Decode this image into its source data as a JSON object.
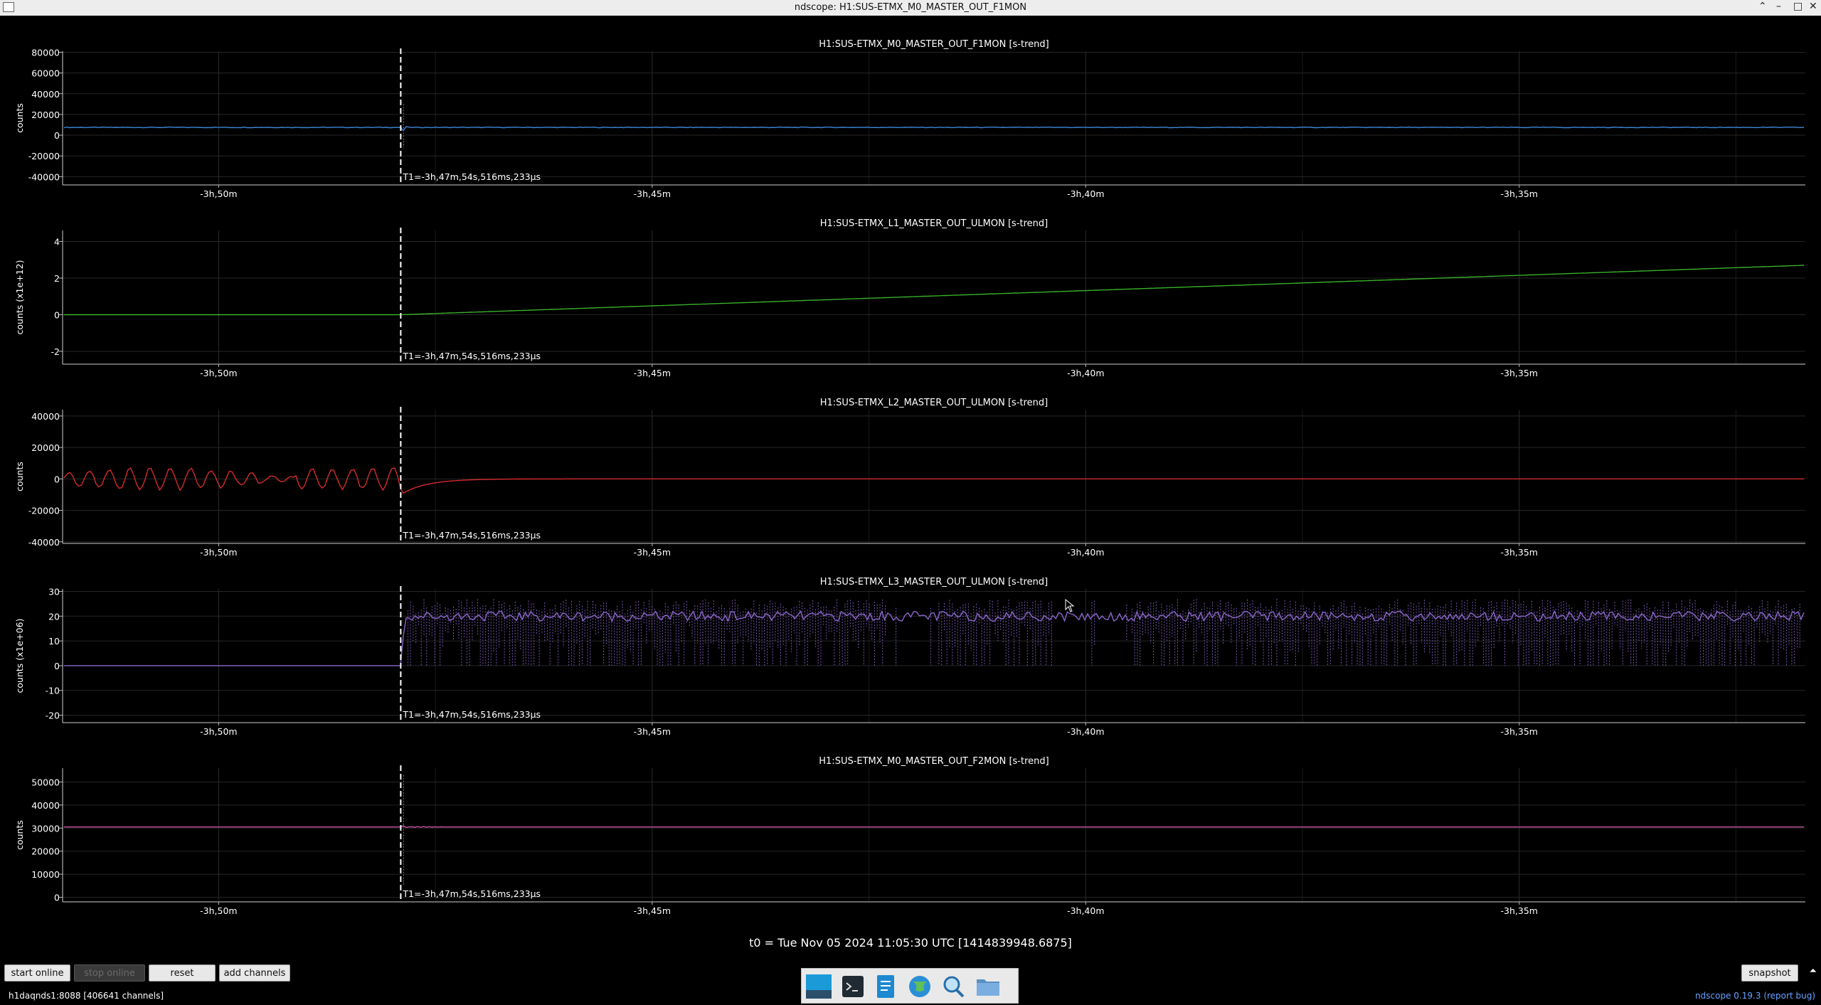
{
  "window": {
    "title": "ndscope: H1:SUS-ETMX_M0_MASTER_OUT_F1MON",
    "controls": [
      "⌃",
      "–",
      "□",
      "✕"
    ]
  },
  "cursor_label": "T1=-3h,47m,54s,516ms,233µs",
  "time_axis": {
    "ticks": [
      "-3h,50m",
      "-3h,45m",
      "-3h,40m",
      "-3h,35m"
    ],
    "tick_values_min": [
      -230,
      -225,
      -220,
      -215
    ],
    "range_min": [
      -231.8,
      -211.7
    ],
    "cursor_min": -227.9
  },
  "plots": [
    {
      "title": "H1:SUS-ETMX_M0_MASTER_OUT_F1MON [s-trend]",
      "ylabel": "counts",
      "yticks": [
        "80000",
        "60000",
        "40000",
        "20000",
        "0",
        "-20000",
        "-40000"
      ],
      "ytick_values": [
        80000,
        60000,
        40000,
        20000,
        0,
        -20000,
        -40000
      ],
      "ylim": [
        -48000,
        81000
      ],
      "color": "#3f86d6",
      "shape": "flat",
      "level": 7500
    },
    {
      "title": "H1:SUS-ETMX_L1_MASTER_OUT_ULMON [s-trend]",
      "ylabel": "counts (x1e+12)",
      "yticks": [
        "4",
        "2",
        "0",
        "-2"
      ],
      "ytick_values": [
        4,
        2,
        0,
        -2
      ],
      "ylim": [
        -2.7,
        4.6
      ],
      "color": "#39b22a",
      "shape": "ramp",
      "level": 0,
      "end_value": 2.7
    },
    {
      "title": "H1:SUS-ETMX_L2_MASTER_OUT_ULMON [s-trend]",
      "ylabel": "counts",
      "yticks": [
        "40000",
        "20000",
        "0",
        "-20000",
        "-40000"
      ],
      "ytick_values": [
        40000,
        20000,
        0,
        -20000,
        -40000
      ],
      "ylim": [
        -41000,
        44000
      ],
      "color": "#d42b2b",
      "shape": "oscillate",
      "level": 0
    },
    {
      "title": "H1:SUS-ETMX_L3_MASTER_OUT_ULMON [s-trend]",
      "ylabel": "counts (x1e+06)",
      "yticks": [
        "30",
        "20",
        "10",
        "0",
        "-10",
        "-20"
      ],
      "ytick_values": [
        30,
        20,
        10,
        0,
        -10,
        -20
      ],
      "ylim": [
        -23,
        31
      ],
      "color": "#8a66cc",
      "shape": "noisy",
      "level": 20
    },
    {
      "title": "H1:SUS-ETMX_M0_MASTER_OUT_F2MON [s-trend]",
      "ylabel": "counts",
      "yticks": [
        "50000",
        "40000",
        "30000",
        "20000",
        "10000",
        "0"
      ],
      "ytick_values": [
        50000,
        40000,
        30000,
        20000,
        10000,
        0
      ],
      "ylim": [
        -2000,
        56000
      ],
      "color": "#c24fa3",
      "shape": "flat_spike",
      "level": 30500
    }
  ],
  "t0_label": "t0 = Tue Nov 05 2024 11:05:30 UTC [1414839948.6875]",
  "buttons": {
    "start_online": "start online",
    "stop_online": "stop online",
    "reset": "reset",
    "add_channels": "add channels",
    "snapshot": "snapshot"
  },
  "status": "h1daqnds1:8088  [406641 channels]",
  "version": {
    "name": "ndscope 0.19.3",
    "report": "report bug"
  },
  "taskbar_icons": [
    "desktop-icon",
    "terminal-icon",
    "text-editor-icon",
    "browser-icon",
    "search-icon",
    "folder-icon"
  ]
}
